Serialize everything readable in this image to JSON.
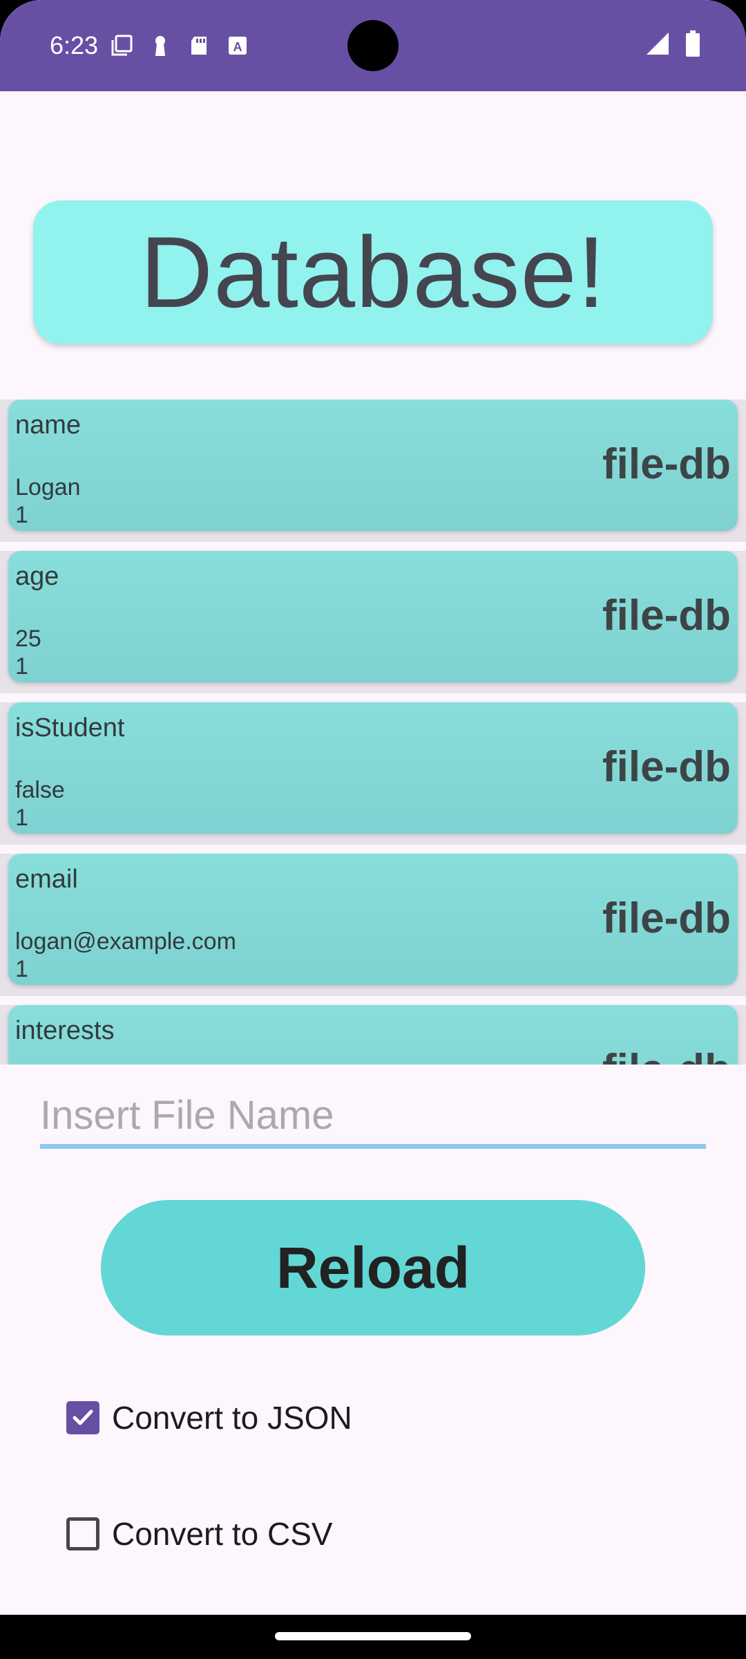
{
  "status_bar": {
    "time": "6:23",
    "left_icons": [
      "screen-record-icon",
      "keyhole-icon",
      "sd-card-icon",
      "font-a-icon"
    ],
    "right_icons": [
      "signal-icon",
      "battery-icon"
    ]
  },
  "title": "Database!",
  "rows": [
    {
      "key": "name",
      "value": "Logan",
      "count": "1",
      "tag": "file-db"
    },
    {
      "key": "age",
      "value": "25",
      "count": "1",
      "tag": "file-db"
    },
    {
      "key": "isStudent",
      "value": "false",
      "count": "1",
      "tag": "file-db"
    },
    {
      "key": "email",
      "value": "logan@example.com",
      "count": "1",
      "tag": "file-db"
    },
    {
      "key": "interests",
      "value": "",
      "count": "",
      "tag": "file-db"
    }
  ],
  "file_input": {
    "placeholder": "Insert File Name",
    "value": ""
  },
  "reload_label": "Reload",
  "options": [
    {
      "label": "Convert to JSON",
      "checked": true
    },
    {
      "label": "Convert to CSV",
      "checked": false
    }
  ],
  "colors": {
    "status_bar": "#6750A4",
    "title_bg": "#92F2EE",
    "card_bg": "#84D9D7",
    "button_bg": "#62D7D5",
    "checkbox": "#6750A4"
  }
}
